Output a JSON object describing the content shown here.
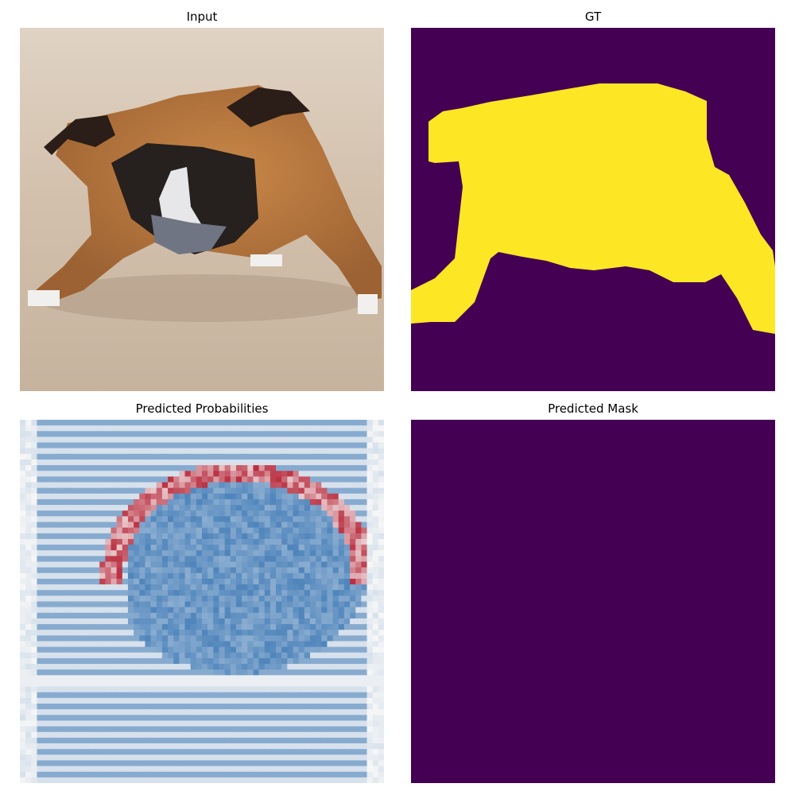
{
  "figure": {
    "panels": [
      {
        "title": "Input"
      },
      {
        "title": "GT"
      },
      {
        "title": "Predicted Probabilities"
      },
      {
        "title": "Predicted Mask"
      }
    ]
  },
  "colors": {
    "mask_background": "#440154",
    "mask_foreground": "#fde725",
    "prob_low": "#2f6fb0",
    "prob_mid": "#f7f7f7",
    "prob_high": "#b2182b"
  },
  "image_content": {
    "input": "pixelated photo of a dog with a dark muzzle on a beige floor",
    "gt_mask_shape": "yellow dog-shaped region on purple background",
    "predicted_mask": "uniform background (no foreground predicted)"
  }
}
